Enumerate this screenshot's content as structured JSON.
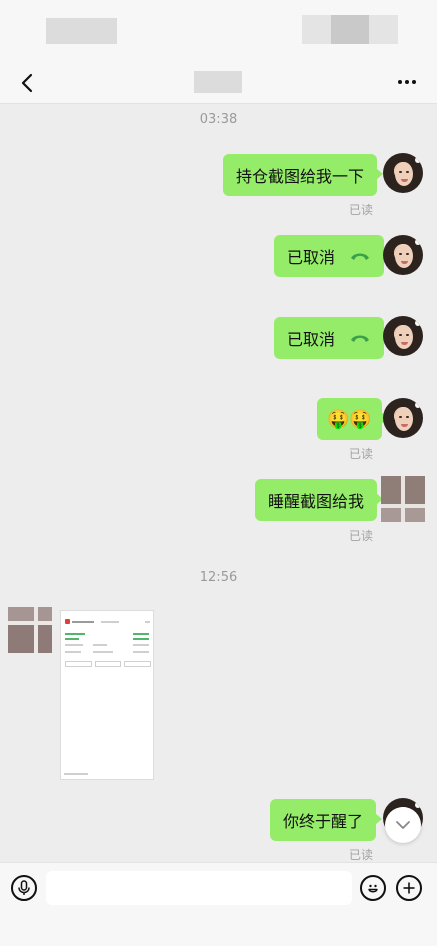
{
  "chat": {
    "timestamps": [
      "03:38",
      "12:56"
    ],
    "messages": [
      {
        "text": "持仓截图给我一下",
        "status": "已读"
      },
      {
        "text": "已取消"
      },
      {
        "text": "已取消"
      },
      {
        "text": "🤑🤑",
        "status": "已读"
      },
      {
        "text": "睡醒截图给我",
        "status": "已读"
      },
      {
        "text": "你终于醒了",
        "status": "已读"
      }
    ]
  },
  "icons": {
    "back": "chevron-left-icon",
    "more": "more-icon",
    "call": "phone-hangup-icon",
    "voice": "microphone-icon",
    "emoji": "emoji-icon",
    "add": "plus-icon",
    "scroll": "chevron-down-icon"
  },
  "colors": {
    "bubble_green": "#95ec69",
    "background": "#ededed",
    "call_icon": "#3aa14a"
  },
  "input": {
    "value": ""
  }
}
